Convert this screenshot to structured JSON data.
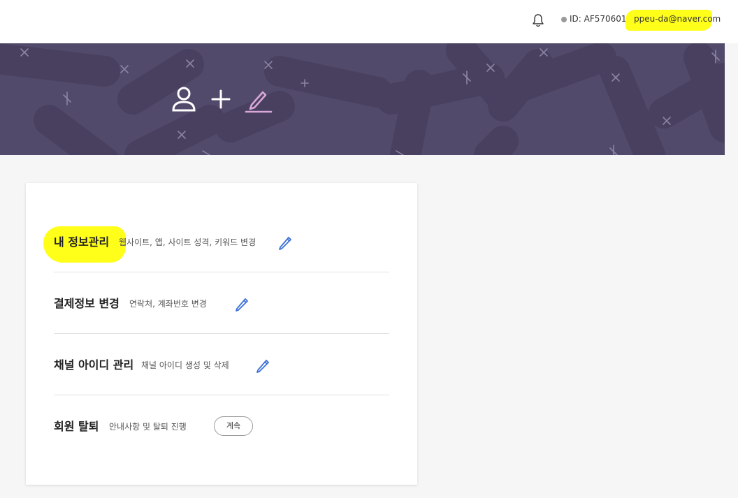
{
  "header": {
    "bell_icon": "bell-icon",
    "user_id": "ID: AF5706017",
    "user_email": "ppeu-da@naver.com",
    "highlight_color": "#ffff1a"
  },
  "banner": {
    "background": "#524a6a",
    "icons": [
      "user-icon",
      "plus-icon",
      "edit-icon"
    ]
  },
  "menu": {
    "items": [
      {
        "title": "내 정보관리",
        "desc": "웹사이트, 앱, 사이트 성격, 키워드 변경",
        "action_icon": "pencil-icon"
      },
      {
        "title": "결제정보 변경",
        "desc": "연락처, 계좌번호 변경",
        "action_icon": "pencil-icon"
      },
      {
        "title": "채널 아이디 관리",
        "desc": "채널 아이디 생성 및 삭제",
        "action_icon": "pencil-icon"
      },
      {
        "title": "회원 탈퇴",
        "desc": "안내사항 및 탈퇴 진행",
        "action_label": "계속"
      }
    ]
  },
  "accent_color": "#3a6fd8"
}
